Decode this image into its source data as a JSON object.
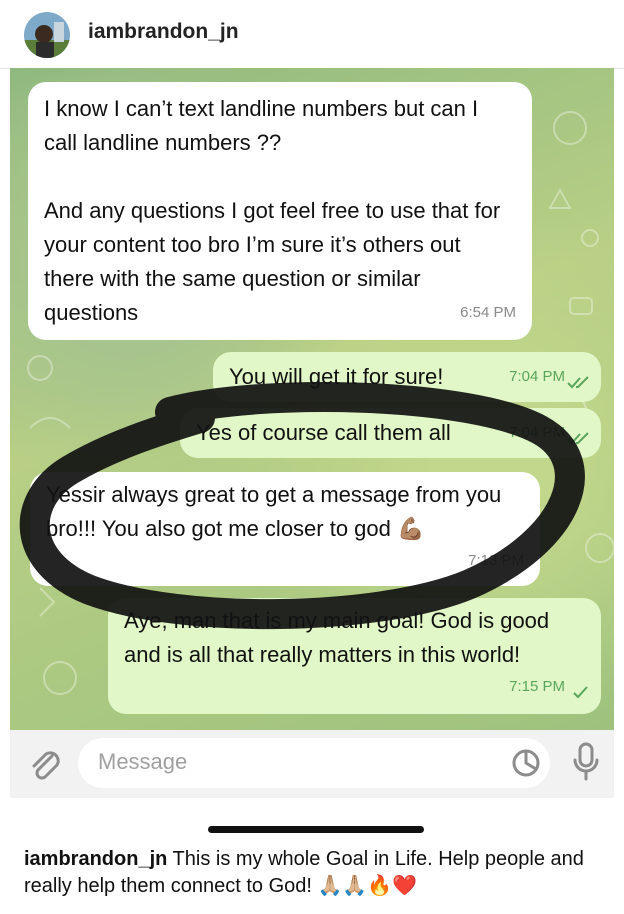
{
  "header": {
    "username": "iambrandon_jn"
  },
  "messages": [
    {
      "text": "I know I can’t text landline numbers but can I call landline numbers ??\n\nAnd any questions I got feel free to use that for your content too bro I’m sure it’s others out there with the same question or similar questions",
      "time": "6:54 PM",
      "direction": "incoming"
    },
    {
      "text": "You will get it for sure!",
      "time": "7:04 PM",
      "direction": "outgoing",
      "status": "read"
    },
    {
      "text": "Yes of course call them all",
      "time": "7:04 PM",
      "direction": "outgoing",
      "status": "read"
    },
    {
      "text": "Yessir always great to get a message from you bro!!! You also got me closer to god",
      "emoji": "💪🏽",
      "time": "7:13 PM",
      "direction": "incoming"
    },
    {
      "text": "Aye, man that is my main goal! God is good and is all that really matters in this world!",
      "time": "7:15 PM",
      "direction": "outgoing",
      "status": "sent"
    }
  ],
  "composer": {
    "placeholder": "Message"
  },
  "caption": {
    "username": "iambrandon_jn",
    "text": " This is my whole Goal in Life.  Help people and really help them connect to God! 🙏🏼🙏🏼🔥❤️"
  },
  "colors": {
    "incoming_bubble": "#ffffff",
    "outgoing_bubble": "#e1f7c7",
    "check_marks": "#5aa55d",
    "ink_circle": "#111111"
  }
}
